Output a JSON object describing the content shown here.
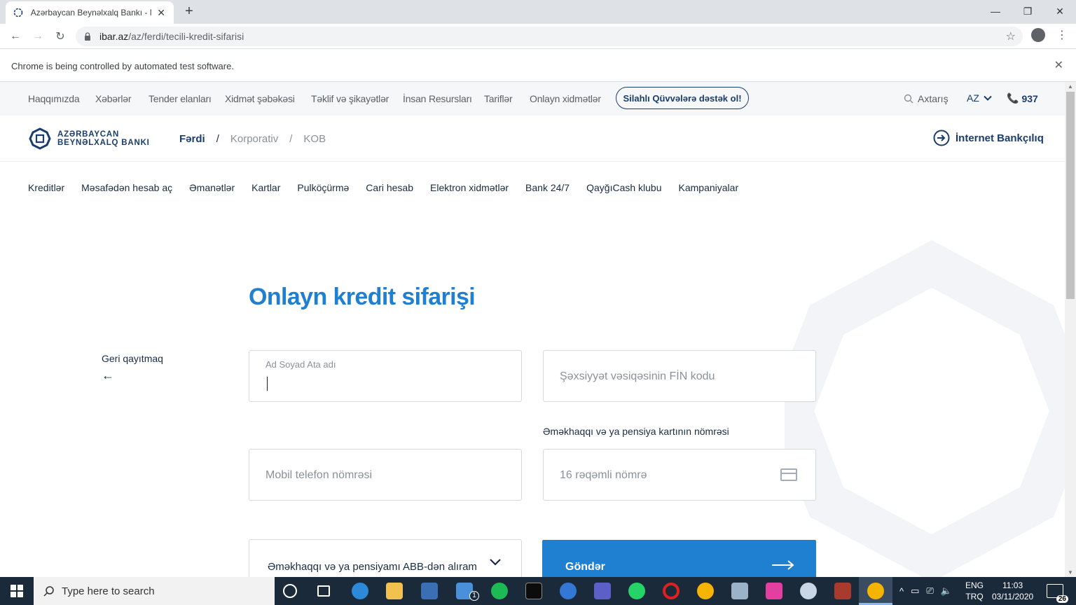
{
  "browser": {
    "tab_title": "Azərbaycan Beynəlxalq Bankı - M",
    "url_host": "ibar.az",
    "url_path": "/az/ferdi/tecili-kredit-sifarisi",
    "automation_notice": "Chrome is being controlled by automated test software."
  },
  "topnav": {
    "items": [
      "Haqqımızda",
      "Xəbərlər",
      "Tender elanları",
      "Xidmət şəbəkəsi",
      "Təklif və şikayətlər",
      "İnsan Resursları",
      "Tariflər",
      "Onlayn xidmətlər"
    ],
    "support_pill": "Silahlı Qüvvələrə dəstək ol!",
    "search": "Axtarış",
    "lang": "AZ",
    "phone": "937"
  },
  "header": {
    "logo_line1": "AZƏRBAYCAN",
    "logo_line2": "BEYNƏLXALQ BANKI",
    "segments": [
      "Fərdi",
      "Korporativ",
      "KOB"
    ],
    "separator": "/",
    "internet_banking": "İnternet Bankçılıq"
  },
  "mainnav": [
    "Kreditlər",
    "Məsafədən hesab aç",
    "Əmanətlər",
    "Kartlar",
    "Pulköçürmə",
    "Cari hesab",
    "Elektron xidmətlər",
    "Bank 24/7",
    "QayğıCash klubu",
    "Kampaniyalar"
  ],
  "form": {
    "title": "Onlayn kredit sifarişi",
    "back_label": "Geri qayıtmaq",
    "back_arrow": "←",
    "name_label": "Ad Soyad Ata adı",
    "fin_placeholder": "Şəxsiyyət vəsiqəsinin FİN kodu",
    "card_label": "Əməkhaqqı və ya pensiya kartının nömrəsi",
    "phone_placeholder": "Mobil telefon nömrəsi",
    "card_placeholder": "16 rəqəmli nömrə",
    "select_value": "Əməkhaqqı və ya pensiyamı ABB-dən alıram",
    "submit_label": "Göndər"
  },
  "taskbar": {
    "search_text": "Type here to search",
    "lang_line1": "ENG",
    "lang_line2": "TRQ",
    "time": "11:03",
    "date": "03/11/2020",
    "notification_count": "26",
    "mail_badge": "1"
  },
  "colors": {
    "brand_navy": "#1a3d6d",
    "brand_blue": "#1f7fd1",
    "taskbar": "#1b2a3a"
  }
}
